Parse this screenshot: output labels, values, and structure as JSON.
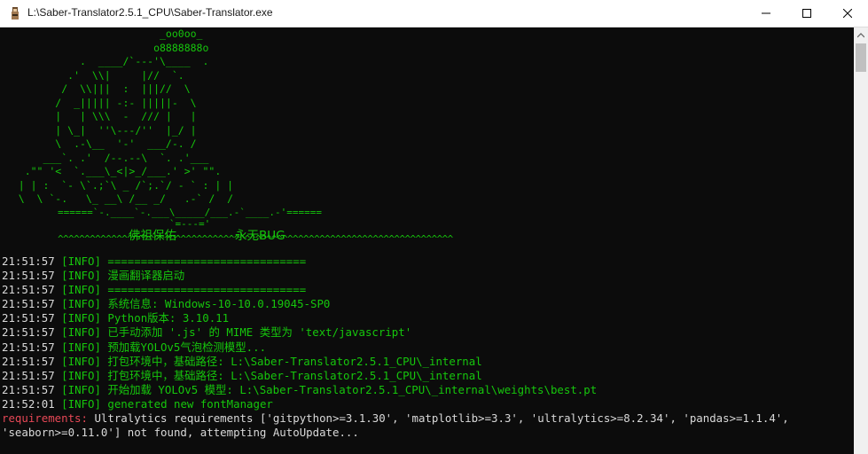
{
  "window": {
    "title": "L:\\Saber-Translator2.5.1_CPU\\Saber-Translator.exe",
    "accent": "#16c60c",
    "error_color": "#e74856"
  },
  "titlebar_buttons": {
    "minimize": "minimize-icon",
    "maximize": "maximize-icon",
    "close": "close-icon"
  },
  "ascii_art": {
    "buddha_lines": "                          _oo0oo_\n                         o8888888o\n             .  ____/`---'\\____  .\n           .'  \\\\|     |//  `.\n          /  \\\\|||  :  |||//  \\\n         /  _||||| -:- |||||-  \\\n         |   | \\\\\\  -  /// |   |\n         | \\_|  ''\\---/''  |_/ |\n         \\  .-\\__  '-'  ___/-. /\n       ___`. .'  /--.--\\  `. .'___\n    .\"\" '<  `.___\\_<|>_/___.' >' \"\".\n   | | :  `- \\`.;`\\ _ /`;.`/ - ` : | |\n   \\  \\ `-.   \\_ __\\ /__ _/   .-` /  /\n",
    "base_line": "======`-.____`-.___\\_____/___.-`____.-'======",
    "tail_line": "                   `=---='",
    "tilde_line": "^^^^^^^^^^^^^^^^^^^^^^^^^^^^^^^^^^^^^^^^^^^^^^^^^^^^^^^^^^^^^^^^^^^^^^^^^^",
    "blessing_1": "佛祖保佑",
    "blessing_2": "永无BUG"
  },
  "log": [
    {
      "time": "21:51:57",
      "level": "[INFO]",
      "message": "=============================="
    },
    {
      "time": "21:51:57",
      "level": "[INFO]",
      "message": "漫画翻译器启动"
    },
    {
      "time": "21:51:57",
      "level": "[INFO]",
      "message": "=============================="
    },
    {
      "time": "21:51:57",
      "level": "[INFO]",
      "message": "系统信息: Windows-10-10.0.19045-SP0"
    },
    {
      "time": "21:51:57",
      "level": "[INFO]",
      "message": "Python版本: 3.10.11"
    },
    {
      "time": "21:51:57",
      "level": "[INFO]",
      "message": "已手动添加 '.js' 的 MIME 类型为 'text/javascript'"
    },
    {
      "time": "21:51:57",
      "level": "[INFO]",
      "message": "预加载YOLOv5气泡检测模型..."
    },
    {
      "time": "21:51:57",
      "level": "[INFO]",
      "message": "打包环境中，基础路径: L:\\Saber-Translator2.5.1_CPU\\_internal"
    },
    {
      "time": "21:51:57",
      "level": "[INFO]",
      "message": "打包环境中，基础路径: L:\\Saber-Translator2.5.1_CPU\\_internal"
    },
    {
      "time": "21:51:57",
      "level": "[INFO]",
      "message": "开始加载 YOLOv5 模型: L:\\Saber-Translator2.5.1_CPU\\_internal\\weights\\best.pt"
    },
    {
      "time": "21:52:01",
      "level": "[INFO]",
      "message": "generated new fontManager"
    }
  ],
  "requirements": {
    "label": "requirements:",
    "text": " Ultralytics requirements ['gitpython>=3.1.30', 'matplotlib>=3.3', 'ultralytics>=8.2.34', 'pandas>=1.1.4',",
    "continuation": "'seaborn>=0.11.0'] not found, attempting AutoUpdate..."
  }
}
